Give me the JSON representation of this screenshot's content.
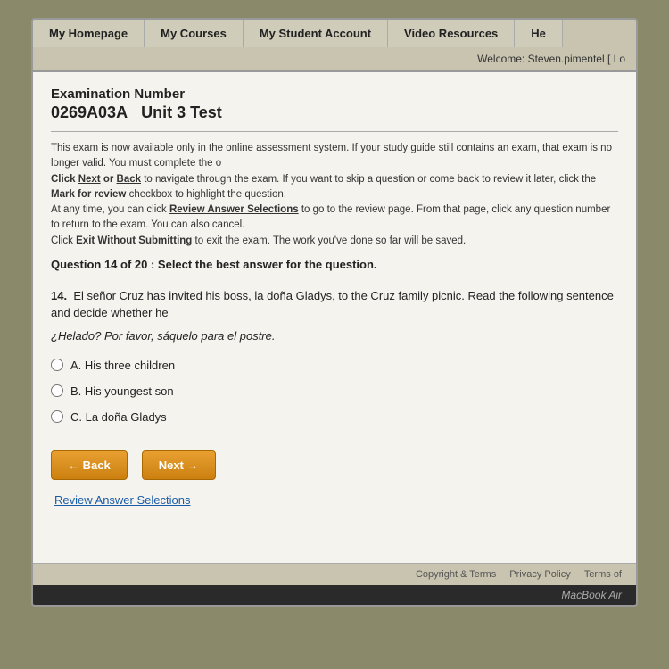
{
  "nav": {
    "items_row1": [
      {
        "label": "My Homepage",
        "name": "nav-homepage"
      },
      {
        "label": "My Courses",
        "name": "nav-courses"
      },
      {
        "label": "My Student Account",
        "name": "nav-student-account"
      },
      {
        "label": "Video Resources",
        "name": "nav-video-resources"
      },
      {
        "label": "He",
        "name": "nav-help"
      }
    ],
    "welcome_text": "Welcome: Steven.pimentel  [ Lo",
    "welcome_name": "nav-welcome"
  },
  "exam": {
    "number_label": "Examination Number",
    "exam_id": "0269A03A",
    "unit_label": "Unit 3 Test",
    "instructions": {
      "line1": "This exam is now available only in the online assessment system. If your study guide still contains an exam, that exam is no longer valid. You must complete the o",
      "line2": "Click Next or Back to navigate through the exam. If you want to skip a question or come back to review it later, click the Mark for review checkbox to highlight th",
      "line3": "At any time, you can click Review Answer Selections to go to the review page. From that page, click any question number to return to the exam. You can also ca",
      "line4": "Click Exit Without Submitting to exit the exam. The work you've done so far will be saved."
    },
    "question_progress": "Question 14 of 20 : Select the best answer for the question.",
    "question_number": "14.",
    "question_text": "El señor Cruz has invited his boss, la doña Gladys, to the Cruz family picnic. Read the following sentence and decide whether he",
    "spanish_sentence": "¿Helado? Por favor, sáquelo para el postre.",
    "answers": [
      {
        "label": "A. His three children",
        "value": "a"
      },
      {
        "label": "B. His youngest son",
        "value": "b"
      },
      {
        "label": "C. La doña Gladys",
        "value": "c"
      }
    ]
  },
  "buttons": {
    "back_label": "← Back",
    "next_label": "Next →",
    "review_label": "Review Answer Selections"
  },
  "footer": {
    "copyright": "Copyright & Terms",
    "privacy": "Privacy Policy",
    "terms": "Terms of"
  },
  "macbook": {
    "label": "MacBook Air"
  }
}
